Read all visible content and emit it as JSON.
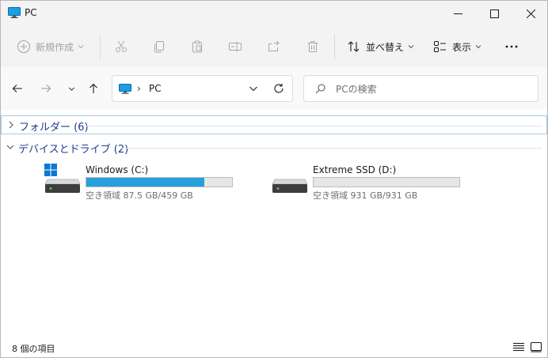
{
  "window": {
    "title": "PC"
  },
  "toolbar": {
    "new_label": "新規作成",
    "sort_label": "並べ替え",
    "view_label": "表示"
  },
  "address": {
    "location": "PC",
    "separator": "›"
  },
  "search": {
    "placeholder": "PCの検索",
    "value": ""
  },
  "groups": {
    "folders": {
      "label": "フォルダー (6)",
      "expanded": false
    },
    "devices": {
      "label": "デバイスとドライブ (2)",
      "expanded": true
    }
  },
  "drives": [
    {
      "name": "Windows (C:)",
      "space": "空き領域 87.5 GB/459 GB",
      "used_fraction": 0.81,
      "system": true
    },
    {
      "name": "Extreme SSD (D:)",
      "space": "空き領域 931 GB/931 GB",
      "used_fraction": 0.0,
      "system": false
    }
  ],
  "status": {
    "item_count": "8 個の項目"
  },
  "colors": {
    "accent": "#26a0da",
    "group_text": "#1e3a8a",
    "windows_logo": "#0a78d4"
  },
  "icons": [
    "pc-icon",
    "minimize-icon",
    "maximize-icon",
    "close-icon",
    "new-icon",
    "cut-icon",
    "copy-icon",
    "paste-icon",
    "rename-icon",
    "share-icon",
    "delete-icon",
    "sort-icon",
    "view-icon",
    "more-icon",
    "back-icon",
    "forward-icon",
    "recent-icon",
    "up-icon",
    "refresh-icon",
    "search-icon",
    "drive-icon",
    "details-view-icon",
    "tiles-view-icon"
  ]
}
